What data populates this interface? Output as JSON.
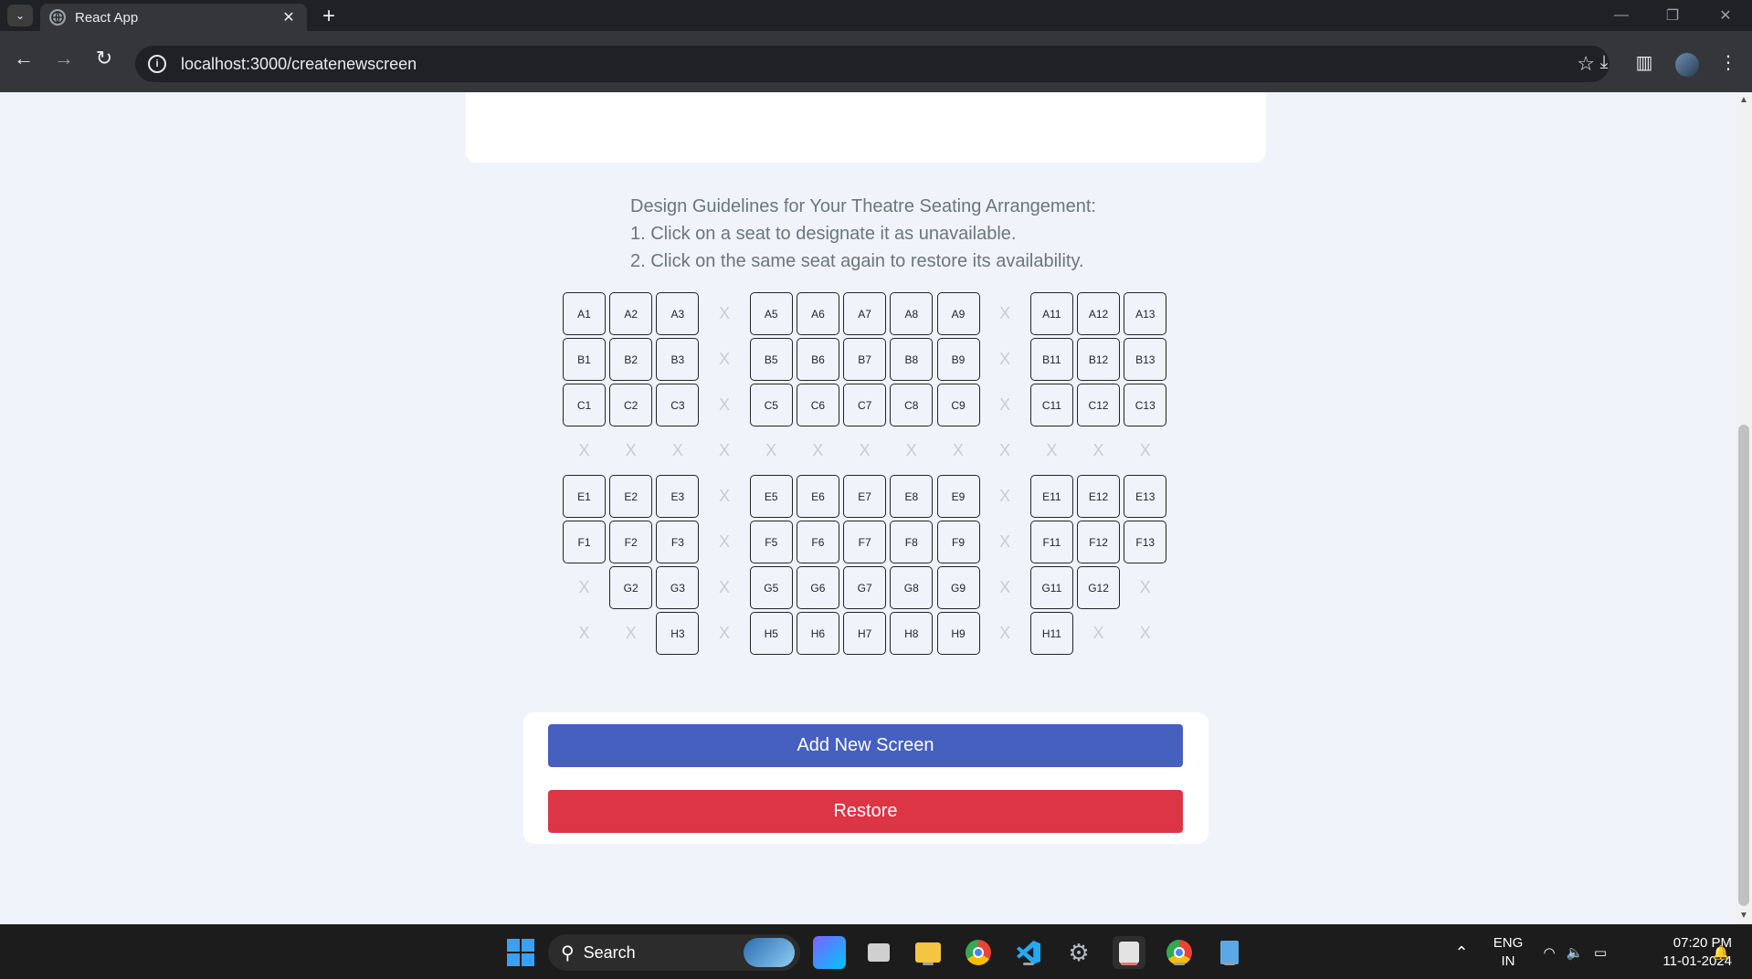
{
  "browser": {
    "tab_title": "React App",
    "url": "localhost:3000/createnewscreen"
  },
  "guidelines": {
    "title": "Design Guidelines for Your Theatre Seating Arrangement:",
    "step1": "1. Click on a seat to designate it as unavailable.",
    "step2": "2. Click on the same seat again to restore its availability."
  },
  "seat_grid": {
    "unavailable_symbol": "X",
    "rows": [
      [
        "A1",
        "A2",
        "A3",
        "X",
        "A5",
        "A6",
        "A7",
        "A8",
        "A9",
        "X",
        "A11",
        "A12",
        "A13"
      ],
      [
        "B1",
        "B2",
        "B3",
        "X",
        "B5",
        "B6",
        "B7",
        "B8",
        "B9",
        "X",
        "B11",
        "B12",
        "B13"
      ],
      [
        "C1",
        "C2",
        "C3",
        "X",
        "C5",
        "C6",
        "C7",
        "C8",
        "C9",
        "X",
        "C11",
        "C12",
        "C13"
      ],
      [
        "X",
        "X",
        "X",
        "X",
        "X",
        "X",
        "X",
        "X",
        "X",
        "X",
        "X",
        "X",
        "X"
      ],
      [
        "E1",
        "E2",
        "E3",
        "X",
        "E5",
        "E6",
        "E7",
        "E8",
        "E9",
        "X",
        "E11",
        "E12",
        "E13"
      ],
      [
        "F1",
        "F2",
        "F3",
        "X",
        "F5",
        "F6",
        "F7",
        "F8",
        "F9",
        "X",
        "F11",
        "F12",
        "F13"
      ],
      [
        "X",
        "G2",
        "G3",
        "X",
        "G5",
        "G6",
        "G7",
        "G8",
        "G9",
        "X",
        "G11",
        "G12",
        "X"
      ],
      [
        "X",
        "X",
        "H3",
        "X",
        "H5",
        "H6",
        "H7",
        "H8",
        "H9",
        "X",
        "H11",
        "X",
        "X"
      ]
    ]
  },
  "actions": {
    "add_label": "Add New Screen",
    "restore_label": "Restore",
    "add_color": "#4560bf",
    "restore_color": "#dc3545"
  },
  "taskbar": {
    "search_label": "Search",
    "lang_line1": "ENG",
    "lang_line2": "IN",
    "time": "07:20 PM",
    "date": "11-01-2024"
  }
}
